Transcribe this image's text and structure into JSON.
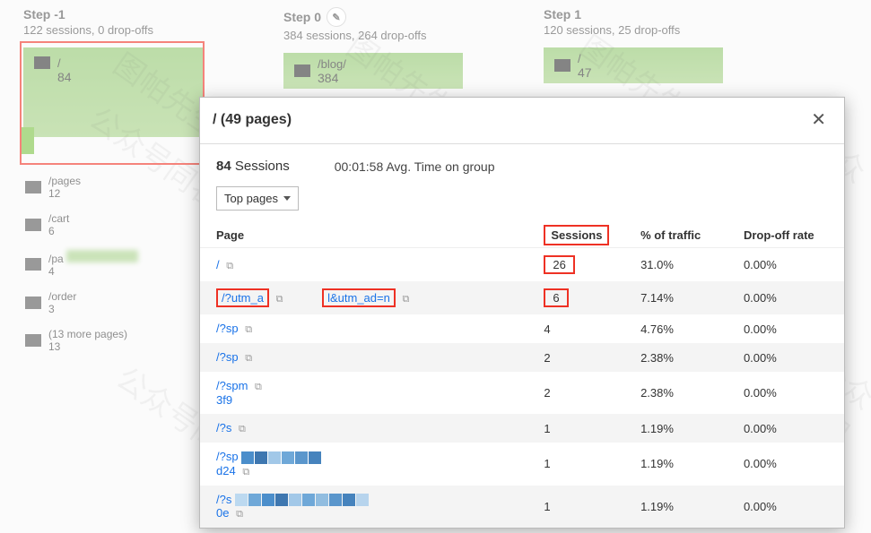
{
  "steps": [
    {
      "title": "Step -1",
      "sub": "122 sessions, 0 drop-offs",
      "card_path": "/",
      "card_num": "84"
    },
    {
      "title": "Step 0",
      "sub": "384 sessions, 264 drop-offs",
      "card_path": "/blog/",
      "card_num": "384"
    },
    {
      "title": "Step 1",
      "sub": "120 sessions, 25 drop-offs",
      "card_path": "/",
      "card_num": "47"
    }
  ],
  "micro": [
    {
      "path": "/pages",
      "num": "12"
    },
    {
      "path": "/cart",
      "num": "6"
    },
    {
      "path": "/pa",
      "num": "4"
    },
    {
      "path": "/order",
      "num": "3"
    },
    {
      "path": "(13 more pages)",
      "num": "13"
    }
  ],
  "modal": {
    "title": "/ (49 pages)",
    "sessions_count": "84",
    "sessions_label": "Sessions",
    "avg_time": "00:01:58 Avg. Time on group",
    "dropdown": "Top pages",
    "headers": {
      "page": "Page",
      "sessions": "Sessions",
      "percent": "% of traffic",
      "dropoff": "Drop-off rate"
    },
    "rows": [
      {
        "page": "/",
        "page2": "",
        "sessions": "26",
        "percent": "31.0%",
        "dropoff": "0.00%",
        "hi": false
      },
      {
        "page": "/?utm_a",
        "page2": "l&utm_ad=n",
        "sessions": "6",
        "percent": "7.14%",
        "dropoff": "0.00%",
        "hi": true
      },
      {
        "page": "/?sp",
        "page2": "",
        "sessions": "4",
        "percent": "4.76%",
        "dropoff": "0.00%",
        "hi": false
      },
      {
        "page": "/?sp",
        "page2": "",
        "sessions": "2",
        "percent": "2.38%",
        "dropoff": "0.00%",
        "hi": false
      },
      {
        "page": "/?spm",
        "page2": "3f9",
        "sessions": "2",
        "percent": "2.38%",
        "dropoff": "0.00%",
        "hi": false
      },
      {
        "page": "/?s",
        "page2": "",
        "sessions": "1",
        "percent": "1.19%",
        "dropoff": "0.00%",
        "hi": false
      },
      {
        "page": "/?sp",
        "page2": "d24",
        "sessions": "1",
        "percent": "1.19%",
        "dropoff": "0.00%",
        "hi": false,
        "bars": [
          "#4b8ecb",
          "#3e77b0",
          "#a2c8e8",
          "#6fa8d8",
          "#5a96cc",
          "#4683bd"
        ]
      },
      {
        "page": "/?s",
        "page2": "0e",
        "sessions": "1",
        "percent": "1.19%",
        "dropoff": "0.00%",
        "hi": false,
        "bars": [
          "#bcd9f0",
          "#6fa8d8",
          "#4b8ecb",
          "#3e77b0",
          "#a2c8e8",
          "#6fa8d8",
          "#91bde0",
          "#5a96cc",
          "#4683bd",
          "#b7d4ed"
        ]
      }
    ]
  },
  "watermarks": [
    "图帕先生",
    "公众号同名"
  ]
}
